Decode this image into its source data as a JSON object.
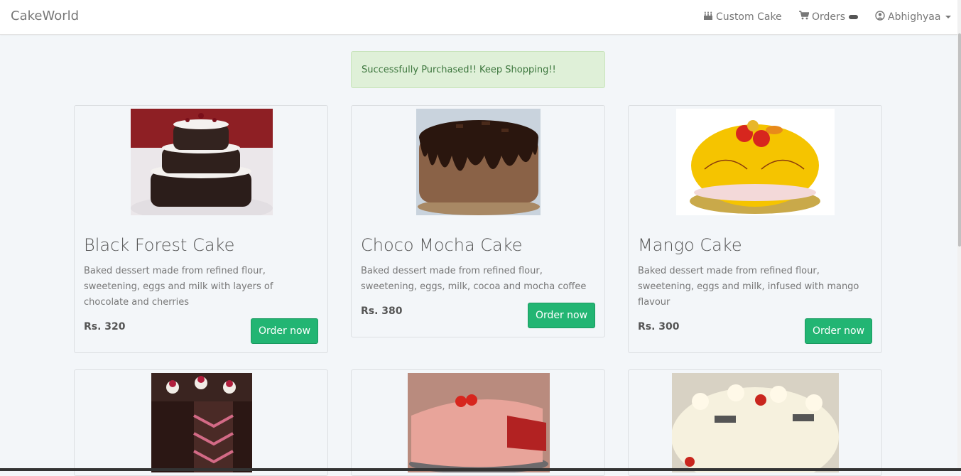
{
  "navbar": {
    "brand": "CakeWorld",
    "custom_cake": "Custom Cake",
    "orders": "Orders",
    "user": "Abhighyaa"
  },
  "alert": {
    "text": "Successfully Purchased!! Keep Shopping!!"
  },
  "cakes": [
    {
      "title": "Black Forest Cake",
      "description": "Baked dessert made from refined flour, sweetening, eggs and milk with layers of chocolate and cherries",
      "price": "Rs. 320",
      "button": "Order now"
    },
    {
      "title": "Choco Mocha Cake",
      "description": "Baked dessert made from refined flour, sweetening, eggs, milk, cocoa and mocha coffee",
      "price": "Rs. 380",
      "button": "Order now"
    },
    {
      "title": "Mango Cake",
      "description": "Baked dessert made from refined flour, sweetening, eggs and milk, infused with mango flavour",
      "price": "Rs. 300",
      "button": "Order now"
    }
  ],
  "colors": {
    "accent": "#22b573",
    "alert_bg": "#dff0d8",
    "alert_text": "#3c763d",
    "page_bg": "#f3f6f9"
  }
}
